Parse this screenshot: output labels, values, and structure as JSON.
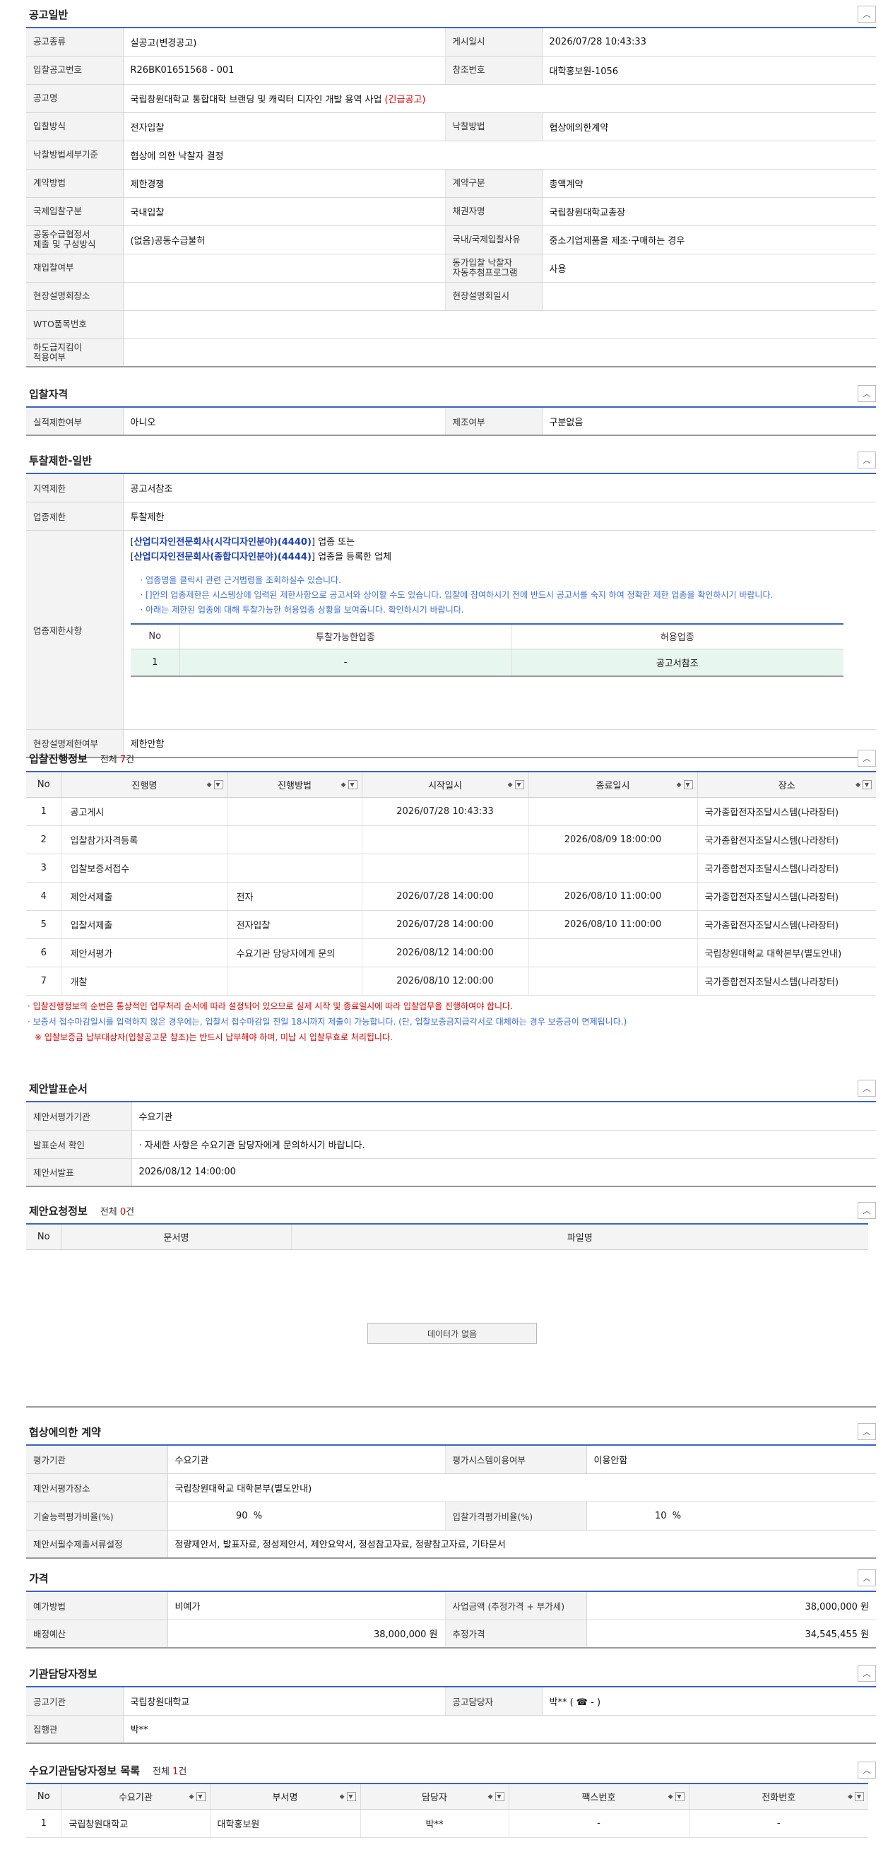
{
  "toggle_icon": "chevron-up-icon",
  "general": {
    "title": "공고일반",
    "rows": [
      {
        "l1": "공고종류",
        "v1": "실공고(변경공고)",
        "l2": "게시일시",
        "v2": "2026/07/28 10:43:33"
      },
      {
        "l1": "입찰공고번호",
        "v1": "R26BK01651568 - 001",
        "l2": "참조번호",
        "v2": "대학홍보원-1056"
      }
    ],
    "name_label": "공고명",
    "name_value": "국립창원대학교 통합대학 브랜딩 및 캐릭터 디자인 개발 용역 사업",
    "name_badge": "(긴급공고)",
    "rows2": [
      {
        "l1": "입찰방식",
        "v1": "전자입찰",
        "l2": "낙찰방법",
        "v2": "협상에의한계약"
      }
    ],
    "detail_label": "낙찰방법세부기준",
    "detail_value": "협상에 의한 낙찰자 결정",
    "rows3": [
      {
        "l1": "계약방법",
        "v1": "제한경쟁",
        "l2": "계약구분",
        "v2": "총액계약"
      },
      {
        "l1": "국제입찰구분",
        "v1": "국내입찰",
        "l2": "채권자명",
        "v2": "국립창원대학교총장"
      },
      {
        "l1": "공동수급협정서\n제출 및 구성방식",
        "v1": "(없음)공동수급불허",
        "l2": "국내/국제입찰사유",
        "v2": "중소기업제품을 제조·구매하는 경우"
      },
      {
        "l1": "재입찰여부",
        "v1": "",
        "l2": "동가입찰 낙찰자\n자동추첨프로그램",
        "v2": "사용"
      },
      {
        "l1": "현장설명회장소",
        "v1": "",
        "l2": "현장설명회일시",
        "v2": ""
      }
    ],
    "wto_label": "WTO품목번호",
    "wto_value": "",
    "sub_label": "하도급지킴이\n적용여부",
    "sub_value": ""
  },
  "qualification": {
    "title": "입찰자격",
    "l1": "실적제한여부",
    "v1": "아니오",
    "l2": "제조여부",
    "v2": "구분없음"
  },
  "restriction": {
    "title": "투찰제한-일반",
    "region_label": "지역제한",
    "region_value": "공고서참조",
    "industry_label": "업종제한",
    "industry_value": "투찰제한",
    "detail_label": "업종제한사항",
    "line1_pre": "[",
    "line1_link": "산업디자인전문회사(시각디자인분야)(4440)",
    "line1_post": "] 업종 또는",
    "line2_pre": "[",
    "line2_link": "산업디자인전문회사(종합디자인분야)(4444)",
    "line2_post": "] 업종을 등록한 업체",
    "notes": [
      "업종명을 클릭시 관련 근거법령을 조회하실수 있습니다.",
      "[]안의 업종제한은 시스템상에 입력된 제한사항으로 공고서와 상이할 수도 있습니다. 입찰에 참여하시기 전에 반드시 공고서를 숙지 하여 정확한 제한 업종을 확인하시기 바랍니다.",
      "아래는 제한된 업종에 대해 투찰가능한 허용업종 상황을 보여줍니다. 확인하시기 바랍니다."
    ],
    "inner_headers": [
      "No",
      "투찰가능한업종",
      "허용업종"
    ],
    "inner_row": [
      "1",
      "-",
      "공고서참조"
    ],
    "site_label": "현장설명제한여부",
    "site_value": "제한안함"
  },
  "progress": {
    "title": "입찰진행정보",
    "count_pre": "전체 ",
    "count": "7",
    "count_post": "건",
    "headers": [
      "No",
      "진행명",
      "진행방법",
      "시작일시",
      "종료일시",
      "장소"
    ],
    "rows": [
      [
        "1",
        "공고게시",
        "",
        "2026/07/28 10:43:33",
        "",
        "국가종합전자조달시스템(나라장터)"
      ],
      [
        "2",
        "입찰참가자격등록",
        "",
        "",
        "2026/08/09 18:00:00",
        "국가종합전자조달시스템(나라장터)"
      ],
      [
        "3",
        "입찰보증서접수",
        "",
        "",
        "",
        "국가종합전자조달시스템(나라장터)"
      ],
      [
        "4",
        "제안서제출",
        "전자",
        "2026/07/28 14:00:00",
        "2026/08/10 11:00:00",
        "국가종합전자조달시스템(나라장터)"
      ],
      [
        "5",
        "입찰서제출",
        "전자입찰",
        "2026/07/28 14:00:00",
        "2026/08/10 11:00:00",
        "국가종합전자조달시스템(나라장터)"
      ],
      [
        "6",
        "제안서평가",
        "수요기관 담당자에게 문의",
        "2026/08/12 14:00:00",
        "",
        "국립창원대학교 대학본부(별도안내)"
      ],
      [
        "7",
        "개찰",
        "",
        "2026/08/10 12:00:00",
        "",
        "국가종합전자조달시스템(나라장터)"
      ]
    ],
    "warn1": "입찰진행정보의 순번은 통상적인 업무처리 순서에 따라 설정되어 있으므로 실제 시작 및 종료일시에 따라 입찰업무을 진행하여야 합니다.",
    "warn2": "보증서 접수마감일시를 입력하지 않은 경우에는, 입찰서 접수마감일 전일 18시까지 제출이 가능합니다. (단, 입찰보증금지급각서로 대체하는 경우 보증금이 면제됩니다.)",
    "warn3": "※ 입찰보증금 납부대상자(입찰공고문 참조)는 반드시 납부해야 하며, 미납 시 입찰무효로 처리됩니다."
  },
  "presentation": {
    "title": "제안발표순서",
    "rows": [
      {
        "l": "제안서평가기관",
        "v": "수요기관"
      },
      {
        "l": "발표순서 확인",
        "v": "자세한 사항은 수요기관 담당자에게 문의하시기 바랍니다."
      },
      {
        "l": "제안서발표",
        "v": "2026/08/12 14:00:00"
      }
    ]
  },
  "request": {
    "title": "제안요청정보",
    "count_pre": "전체 ",
    "count": "0",
    "count_post": "건",
    "headers": [
      "No",
      "문서명",
      "파일명"
    ],
    "nodata": "데이터가 없음"
  },
  "negotiation": {
    "title": "협상에의한 계약",
    "r1": {
      "l1": "평가기관",
      "v1": "수요기관",
      "l2": "평가시스템이용여부",
      "v2": "이용안함"
    },
    "r2": {
      "l": "제안서평가장소",
      "v": "국립창원대학교 대학본부(별도안내)"
    },
    "r3": {
      "l1": "기술능력평가비율(%)",
      "v1": "90",
      "u1": "%",
      "l2": "입찰가격평가비율(%)",
      "v2": "10",
      "u2": "%"
    },
    "r4": {
      "l": "제안서필수제출서류설정",
      "v": "정량제안서, 발표자료, 정성제안서, 제안요약서, 정성참고자료, 정량참고자료, 기타문서"
    }
  },
  "price": {
    "title": "가격",
    "r1": {
      "l1": "예가방법",
      "v1": "비예가",
      "l2": "사업금액 (추정가격 + 부가세)",
      "v2": "38,000,000 원"
    },
    "r2": {
      "l1": "배정예산",
      "v1": "38,000,000 원",
      "l2": "추정가격",
      "v2": "34,545,455 원"
    }
  },
  "agency": {
    "title": "기관담당자정보",
    "r1": {
      "l1": "공고기관",
      "v1": "국립창원대학교",
      "l2": "공고담당자",
      "v2": "박** ( ☎ - )"
    },
    "r2": {
      "l": "집행관",
      "v": "박**"
    }
  },
  "contacts": {
    "title": "수요기관담당자정보 목록",
    "count_pre": "전체 ",
    "count": "1",
    "count_post": "건",
    "headers": [
      "No",
      "수요기관",
      "부서명",
      "담당자",
      "팩스번호",
      "전화번호"
    ],
    "rows": [
      [
        "1",
        "국립창원대학교",
        "대학홍보원",
        "박**",
        "-",
        "-"
      ]
    ]
  }
}
